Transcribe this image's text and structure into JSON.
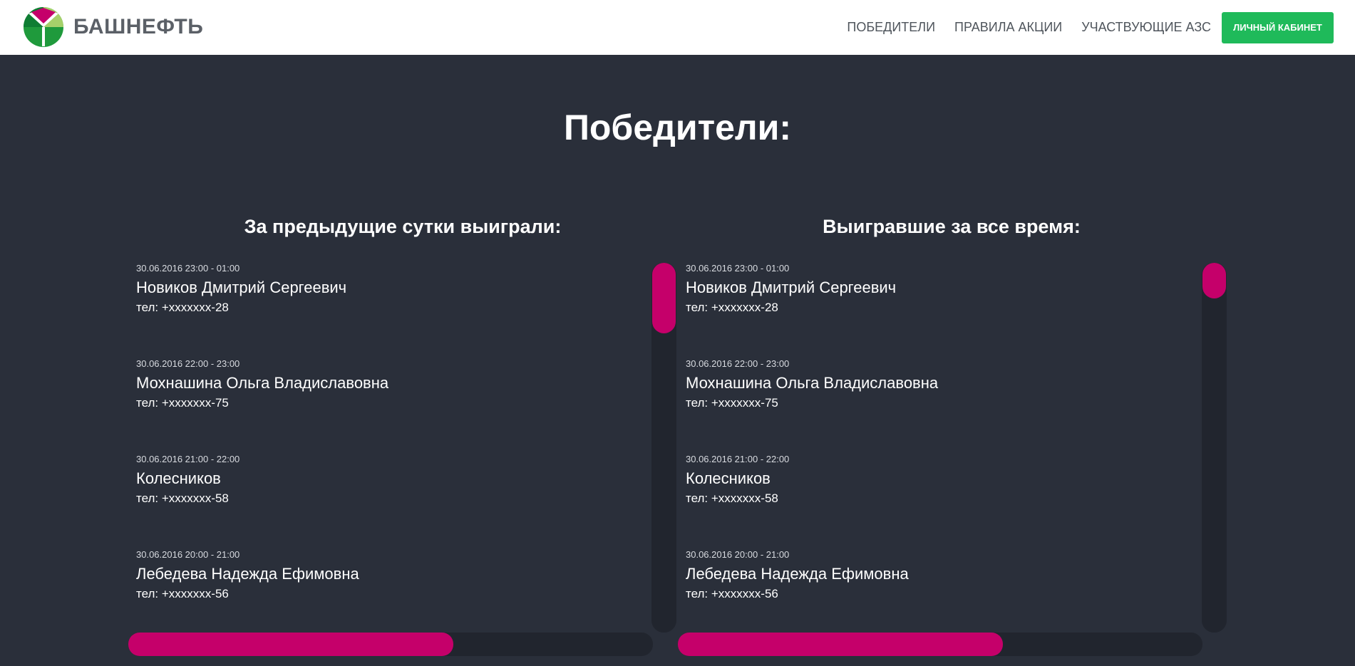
{
  "header": {
    "logo_text": "БАШНЕФТЬ",
    "nav": [
      {
        "label": "ПОБЕДИТЕЛИ"
      },
      {
        "label": "ПРАВИЛА АКЦИИ"
      },
      {
        "label": "УЧАСТВУЮЩИЕ АЗС"
      }
    ],
    "cabinet_label": "ЛИЧНЫЙ КАБИНЕТ"
  },
  "page_title": "Победители:",
  "columns": {
    "left": {
      "title": "За предыдущие сутки выиграли:",
      "entries": [
        {
          "time": "30.06.2016 23:00 - 01:00",
          "name": "Новиков Дмитрий Сергеевич",
          "phone": "тел: +xxxxxxx-28"
        },
        {
          "time": "30.06.2016 22:00 - 23:00",
          "name": "Мохнашина Ольга Владиславовна",
          "phone": "тел: +xxxxxxx-75"
        },
        {
          "time": "30.06.2016 21:00 - 22:00",
          "name": "Колесников",
          "phone": "тел: +xxxxxxx-58"
        },
        {
          "time": "30.06.2016 20:00 - 21:00",
          "name": "Лебедева Надежда Ефимовна",
          "phone": "тел: +xxxxxxx-56"
        }
      ],
      "vertical_scroll_position": 0,
      "horizontal_scroll_visible_fraction": 0.62
    },
    "right": {
      "title": "Выигравшие за все время:",
      "entries": [
        {
          "time": "30.06.2016 23:00 - 01:00",
          "name": "Новиков Дмитрий Сергеевич",
          "phone": "тел: +xxxxxxx-28"
        },
        {
          "time": "30.06.2016 22:00 - 23:00",
          "name": "Мохнашина Ольга Владиславовна",
          "phone": "тел: +xxxxxxx-75"
        },
        {
          "time": "30.06.2016 21:00 - 22:00",
          "name": "Колесников",
          "phone": "тел: +xxxxxxx-58"
        },
        {
          "time": "30.06.2016 20:00 - 21:00",
          "name": "Лебедева Надежда Ефимовна",
          "phone": "тел: +xxxxxxx-56"
        }
      ],
      "vertical_scroll_position": 0,
      "horizontal_scroll_visible_fraction": 0.62
    }
  },
  "colors": {
    "background": "#2a2f3a",
    "accent": "#c5006a",
    "button_green": "#1fba5a",
    "scroll_track": "#21252e"
  },
  "icons": {
    "logo": "bashneft-logo-icon"
  }
}
